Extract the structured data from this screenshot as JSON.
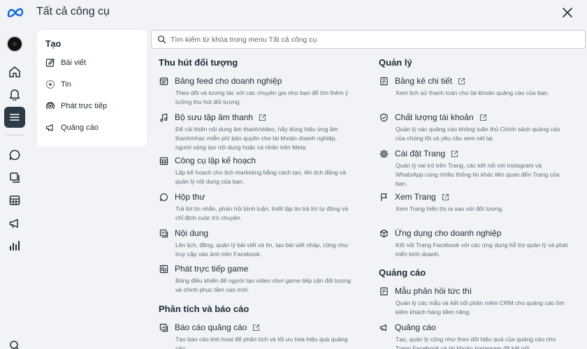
{
  "header": {
    "title": "Tất cả công cụ"
  },
  "search": {
    "placeholder": "Tìm kiếm từ khóa trong menu Tất cả công cụ"
  },
  "sidebar": {
    "heading": "Tạo",
    "items": [
      {
        "label": "Bài viết",
        "icon": "edit-icon"
      },
      {
        "label": "Tin",
        "icon": "story-plus-icon"
      },
      {
        "label": "Phát trực tiếp",
        "icon": "live-icon"
      },
      {
        "label": "Quảng cáo",
        "icon": "megaphone-icon"
      }
    ]
  },
  "sections": {
    "engage": {
      "title": "Thu hút đối tượng",
      "tools": [
        {
          "name": "Bảng feed cho doanh nghiệp",
          "desc": "Theo dõi và tương tác với các chuyên gia như bạn để tìm thêm ý tưởng thu hút đối tượng.",
          "icon": "feed-icon",
          "external": false
        },
        {
          "name": "Bộ sưu tập âm thanh",
          "desc": "Để cải thiện nội dung âm thanh/video, hãy dùng hiệu ứng âm thanh/nhạc miễn phí bản quyền cho tài khoản doanh nghiệp, người sáng tạo nội dung hoặc cá nhân trên Meta.",
          "icon": "music-note-icon",
          "external": true
        },
        {
          "name": "Công cụ lập kế hoạch",
          "desc": "Lập kế hoạch cho lịch marketing bằng cách tạo, lên lịch đăng và quản lý nội dung của bạn.",
          "icon": "calendar-icon",
          "external": false
        },
        {
          "name": "Hộp thư",
          "desc": "Trả lời tin nhắn, phản hồi bình luận, thiết lập tin trả lời tự động và chỉ định cuộc trò chuyện.",
          "icon": "chat-bubble-icon",
          "external": false
        },
        {
          "name": "Nội dung",
          "desc": "Lên lịch, đăng, quản lý bài viết và tin, tạo bài viết nháp, cũng như truy cập vào ảnh trên Facebook.",
          "icon": "content-icon",
          "external": false
        },
        {
          "name": "Phát trực tiếp game",
          "desc": "Bảng điều khiển để người tạo video chơi game tiếp cận đối tượng và chinh phục tầm cao mới.",
          "icon": "game-stream-icon",
          "external": false
        }
      ]
    },
    "analytics": {
      "title": "Phân tích và báo cáo",
      "tools": [
        {
          "name": "Báo cáo quảng cáo",
          "desc": "Tạo báo cáo linh hoạt để phân tích và tối ưu hóa hiệu quả quảng cáo.",
          "icon": "report-icon",
          "external": true
        }
      ]
    },
    "manage": {
      "title": "Quản lý",
      "tools": [
        {
          "name": "Bảng kê chi tiết",
          "desc": "Xem lịch sử thanh toán cho tài khoản quảng cáo của bạn.",
          "icon": "ledger-icon",
          "external": true
        },
        {
          "name": "Chất lượng tài khoản",
          "desc": "Quản lý các quảng cáo không tuân thủ Chính sách quảng cáo của chúng tôi và yêu cầu xem xét lại.",
          "icon": "shield-icon",
          "external": true
        },
        {
          "name": "Cài đặt Trang",
          "desc": "Quản lý vai trò trên Trang, các kết nối với Instagram và WhatsApp cùng nhiều thông tin khác liên quan đến Trang của bạn.",
          "icon": "gear-icon",
          "external": true
        },
        {
          "name": "Xem Trang",
          "desc": "Xem Trang hiển thị ra sao với đối tượng.",
          "icon": "flag-icon",
          "external": true
        },
        {
          "name": "Ứng dụng cho doanh nghiệp",
          "desc": "Kết nối Trang Facebook với các ứng dụng hỗ trợ quản lý và phát triển kinh doanh.",
          "icon": "cube-icon",
          "external": false
        }
      ]
    },
    "ads": {
      "title": "Quảng cáo",
      "tools": [
        {
          "name": "Mẫu phản hồi tức thì",
          "desc": "Quản lý các mẫu và kết nối phần mềm CRM cho quảng cáo tìm kiếm khách hàng tiềm năng.",
          "icon": "form-icon",
          "external": false
        },
        {
          "name": "Quảng cáo",
          "desc": "Tạo, quản lý cũng như theo dõi hiệu quả của quảng cáo cho Trang Facebook và tài khoản Instagram đã kết nối.",
          "icon": "megaphone-icon",
          "external": false
        }
      ]
    }
  },
  "colors": {
    "text": "#1c2b33",
    "muted": "#5d6c76",
    "background": "#f1f3f6",
    "active_rail": "#2b3a44"
  }
}
